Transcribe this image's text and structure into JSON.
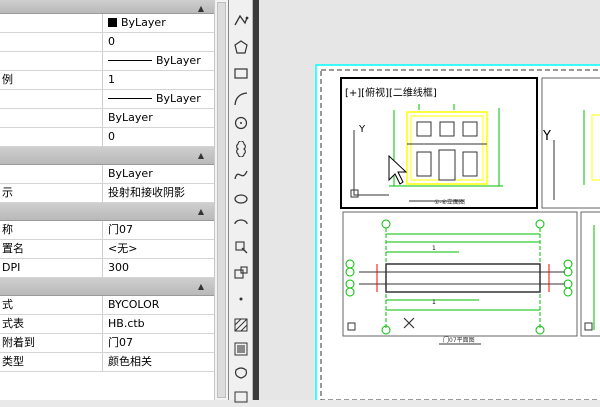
{
  "properties": {
    "rows": [
      {
        "type": "section",
        "name": "section-general"
      },
      {
        "key": "",
        "value": "ByLayer",
        "swatch": true
      },
      {
        "key": "",
        "value": "0"
      },
      {
        "key": "",
        "value": "ByLayer",
        "line": true
      },
      {
        "key": "例",
        "value": "1"
      },
      {
        "key": "",
        "value": "ByLayer",
        "line": true
      },
      {
        "key": "",
        "value": "ByLayer"
      },
      {
        "key": "",
        "value": "0"
      },
      {
        "type": "section",
        "name": "section-3d"
      },
      {
        "key": "",
        "value": "ByLayer"
      },
      {
        "key": "示",
        "value": "投射和接收阴影"
      },
      {
        "type": "section",
        "name": "section-plot"
      },
      {
        "key": "称",
        "value": "门07"
      },
      {
        "key": "置名",
        "value": "<无>"
      },
      {
        "key": "DPI",
        "value": "300"
      },
      {
        "type": "section",
        "name": "section-plot-style"
      },
      {
        "key": "式",
        "value": "BYCOLOR"
      },
      {
        "key": "式表",
        "value": "HB.ctb"
      },
      {
        "key": "附着到",
        "value": "门07"
      },
      {
        "key": "类型",
        "value": "颜色相关"
      }
    ]
  },
  "viewport": {
    "label": "[+][俯视][二维线框]",
    "plan_title": "门07平面图"
  },
  "colors": {
    "accent_cyan": "#00ffff",
    "green": "#00c000",
    "yellow": "#ffff00",
    "red": "#ff0000"
  }
}
